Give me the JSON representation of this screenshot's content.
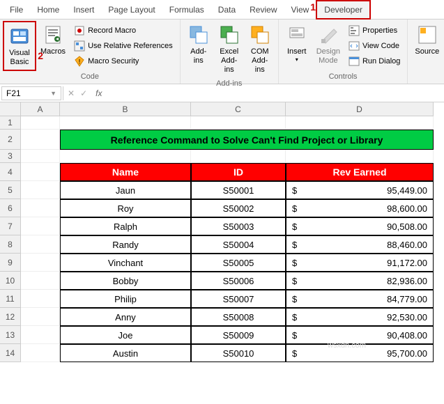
{
  "tabs": {
    "file": "File",
    "home": "Home",
    "insert": "Insert",
    "page_layout": "Page Layout",
    "formulas": "Formulas",
    "data": "Data",
    "review": "Review",
    "view": "View",
    "developer": "Developer"
  },
  "annotations": {
    "one": "1",
    "two": "2"
  },
  "ribbon": {
    "code": {
      "label": "Code",
      "visual_basic": "Visual\nBasic",
      "macros": "Macros",
      "record_macro": "Record Macro",
      "use_relative": "Use Relative References",
      "macro_security": "Macro Security"
    },
    "addins": {
      "label": "Add-ins",
      "addins": "Add-\nins",
      "excel_addins": "Excel\nAdd-ins",
      "com_addins": "COM\nAdd-ins"
    },
    "controls": {
      "label": "Controls",
      "insert": "Insert",
      "design_mode": "Design\nMode",
      "properties": "Properties",
      "view_code": "View Code",
      "run_dialog": "Run Dialog"
    },
    "source": {
      "source": "Source"
    }
  },
  "name_box": "F21",
  "fx": {
    "cancel": "✕",
    "confirm": "✓",
    "fx": "fx"
  },
  "columns": [
    "A",
    "B",
    "C",
    "D"
  ],
  "rows": [
    "1",
    "2",
    "3",
    "4",
    "5",
    "6",
    "7",
    "8",
    "9",
    "10",
    "11",
    "12",
    "13",
    "14"
  ],
  "title": "Reference Command to Solve Can't Find Project or Library",
  "headers": {
    "name": "Name",
    "id": "ID",
    "rev": "Rev Earned"
  },
  "currency": "$",
  "data": [
    {
      "name": "Jaun",
      "id": "S50001",
      "rev": "95,449.00"
    },
    {
      "name": "Roy",
      "id": "S50002",
      "rev": "98,600.00"
    },
    {
      "name": "Ralph",
      "id": "S50003",
      "rev": "90,508.00"
    },
    {
      "name": "Randy",
      "id": "S50004",
      "rev": "88,460.00"
    },
    {
      "name": "Vinchant",
      "id": "S50005",
      "rev": "91,172.00"
    },
    {
      "name": "Bobby",
      "id": "S50006",
      "rev": "82,936.00"
    },
    {
      "name": "Philip",
      "id": "S50007",
      "rev": "84,779.00"
    },
    {
      "name": "Anny",
      "id": "S50008",
      "rev": "92,530.00"
    },
    {
      "name": "Joe",
      "id": "S50009",
      "rev": "90,408.00"
    },
    {
      "name": "Austin",
      "id": "S50010",
      "rev": "95,700.00"
    }
  ],
  "watermark": "wsxdn.com"
}
